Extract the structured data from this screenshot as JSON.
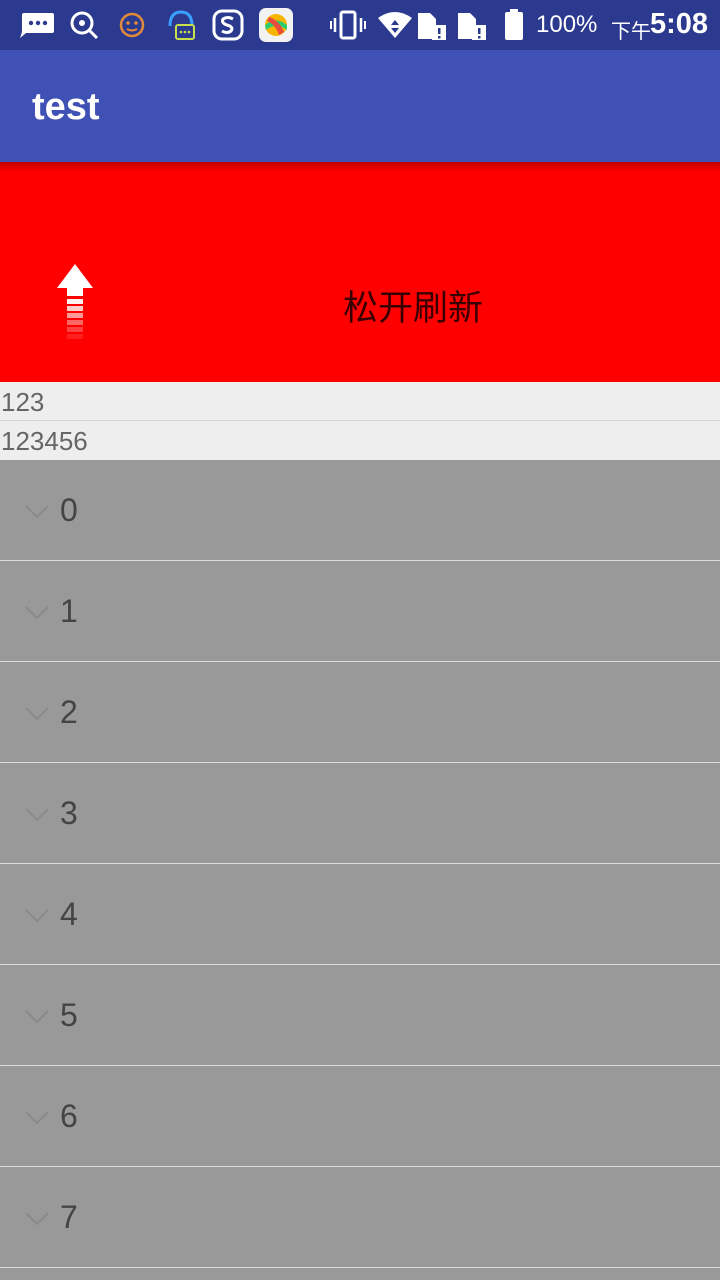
{
  "status_bar": {
    "icons": [
      "chat-bubble-icon",
      "search-q-icon",
      "face-icon",
      "headset-icon",
      "sogou-s-icon",
      "app-ball-icon",
      "vibrate-icon",
      "wifi-icon",
      "sim-alert-icon",
      "sim-alert-icon",
      "battery-icon"
    ],
    "battery": "100%",
    "ampm": "下午",
    "time": "5:08"
  },
  "app_bar": {
    "title": "test"
  },
  "refresh": {
    "label": "松开刷新",
    "icon": "arrow-up-icon"
  },
  "rows": [
    "123",
    "123456"
  ],
  "list": {
    "chevron_icon": "chevron-down-icon",
    "items": [
      "0",
      "1",
      "2",
      "3",
      "4",
      "5",
      "6",
      "7"
    ]
  },
  "colors": {
    "status_bar": "#2b3a8f",
    "app_bar": "#3f51b5",
    "refresh_bg": "#ff0000",
    "list_bg": "#999999"
  }
}
